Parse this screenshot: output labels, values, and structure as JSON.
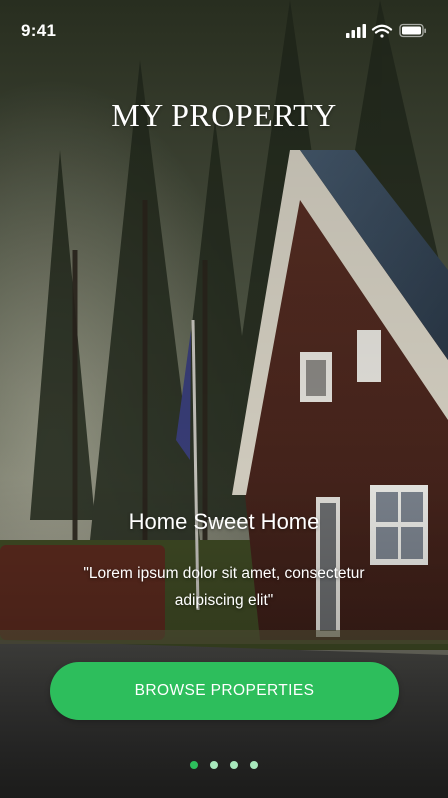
{
  "status_bar": {
    "time": "9:41",
    "icons": [
      "signal-icon",
      "wifi-icon",
      "battery-icon"
    ]
  },
  "brand": {
    "title": "MY PROPERTY"
  },
  "slide": {
    "title": "Home Sweet Home",
    "quote": "\"Lorem ipsum dolor sit amet, consectetur adipiscing elit\""
  },
  "cta": {
    "label": "BROWSE PROPERTIES"
  },
  "pager": {
    "count": 4,
    "active_index": 0
  },
  "colors": {
    "accent": "#2dbe5c",
    "dot_inactive": "#a8e8bc",
    "text": "#ffffff"
  }
}
